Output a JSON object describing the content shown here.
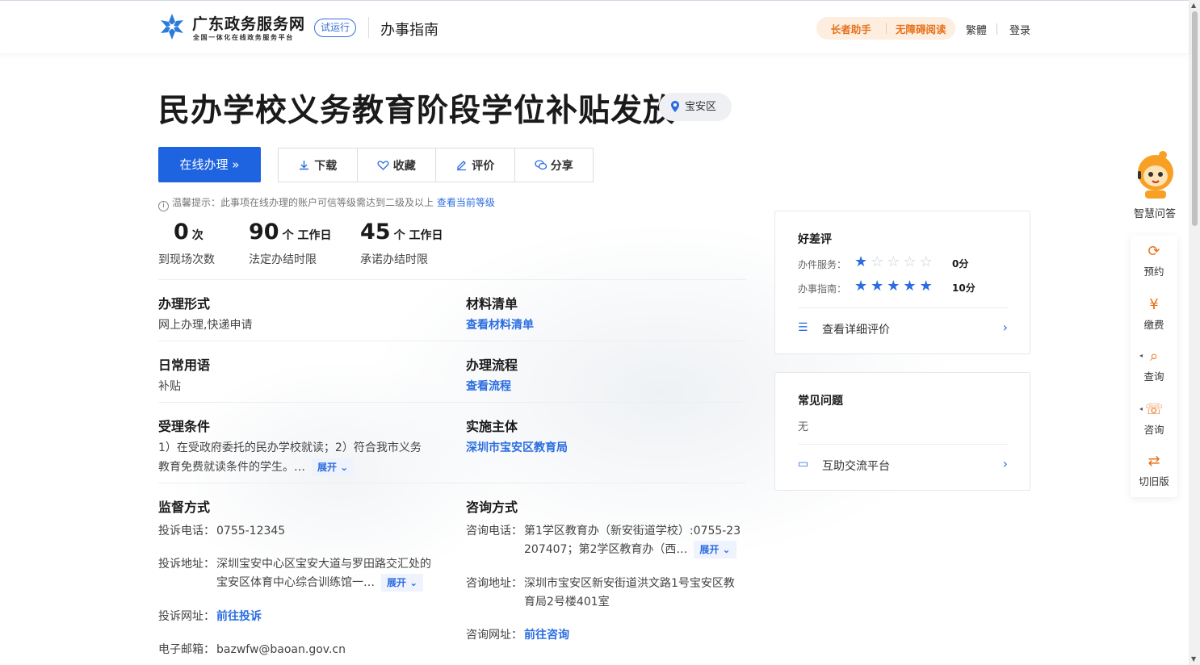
{
  "header": {
    "site_name": "广东政务服务网",
    "site_sub": "全国一体化在线政务服务平台",
    "beta": "试运行",
    "guide": "办事指南",
    "elder": "长者助手",
    "barrier_free": "无障碍阅读",
    "traditional": "繁體",
    "login": "登录"
  },
  "title": "民办学校义务教育阶段学位补贴发放",
  "region": "宝安区",
  "actions": {
    "online": "在线办理 »",
    "download": "下载",
    "favorite": "收藏",
    "evaluate": "评价",
    "share": "分享"
  },
  "tip": {
    "text": "温馨提示：此事项在线办理的账户可信等级需达到二级及以上",
    "link": "查看当前等级"
  },
  "stats": [
    {
      "num": "0",
      "unit": "次",
      "label": "到现场次数"
    },
    {
      "num": "90",
      "unit": "个 工作日",
      "label": "法定办结时限"
    },
    {
      "num": "45",
      "unit": "个 工作日",
      "label": "承诺办结时限"
    }
  ],
  "fields": {
    "form_title": "办理形式",
    "form_value": "网上办理,快递申请",
    "materials_title": "材料清单",
    "materials_link": "查看材料清单",
    "daily_title": "日常用语",
    "daily_value": "补贴",
    "process_title": "办理流程",
    "process_link": "查看流程",
    "condition_title": "受理条件",
    "condition_line1": "1）在受政府委托的民办学校就读；2）符合我市义务",
    "condition_line2": "教育免费就读条件的学生。…",
    "subject_title": "实施主体",
    "subject_link": "深圳市宝安区教育局",
    "expand": "展开 ⌄"
  },
  "supervise": {
    "title": "监督方式",
    "phone_k": "投诉电话：",
    "phone_v": "0755-12345",
    "addr_k": "投诉地址：",
    "addr_v1": "深圳宝安中心区宝安大道与罗田路交汇处的",
    "addr_v2": "宝安区体育中心综合训练馆一…",
    "web_k": "投诉网址：",
    "web_v": "前往投诉",
    "mail_k": "电子邮箱：",
    "mail_v": "bazwfw@baoan.gov.cn"
  },
  "consult": {
    "title": "咨询方式",
    "phone_k": "咨询电话：",
    "phone_v1": "第1学区教育办（新安街道学校）:0755-23",
    "phone_v2": "207407；第2学区教育办（西…",
    "addr_k": "咨询地址：",
    "addr_v1": "深圳市宝安区新安街道洪文路1号宝安区教",
    "addr_v2": "育局2号楼401室",
    "web_k": "咨询网址：",
    "web_v": "前往咨询"
  },
  "review": {
    "title": "好差评",
    "service_label": "办件服务：",
    "service_stars": 1,
    "service_score": "0分",
    "guide_label": "办事指南：",
    "guide_stars": 5,
    "guide_score": "10分",
    "detail": "查看详细评价"
  },
  "faq": {
    "title": "常见问题",
    "none": "无",
    "platform": "互助交流平台"
  },
  "sidebar": {
    "robot": "智慧问答",
    "items": [
      "预约",
      "缴费",
      "查询",
      "咨询",
      "切旧版"
    ]
  },
  "colors": {
    "primary": "#1e63e0",
    "accent": "#e8711a"
  }
}
